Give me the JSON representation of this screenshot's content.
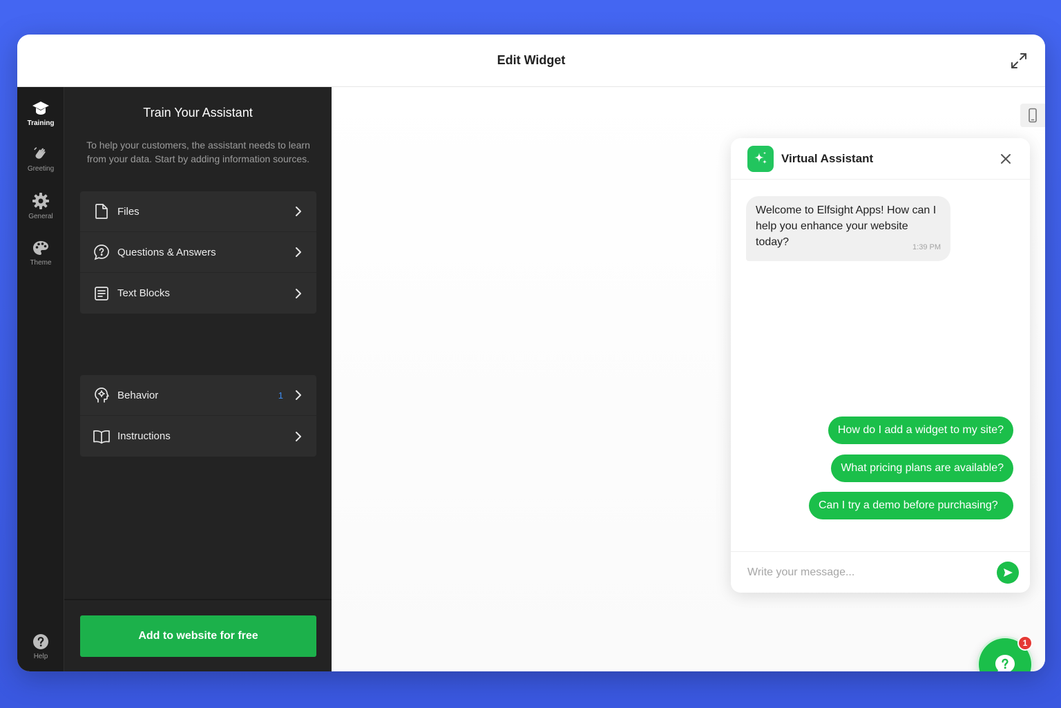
{
  "window": {
    "title": "Edit Widget"
  },
  "rail": {
    "items": [
      {
        "label": "Training",
        "icon": "graduation-cap-icon"
      },
      {
        "label": "Greeting",
        "icon": "waving-hand-icon"
      },
      {
        "label": "General",
        "icon": "gear-icon"
      },
      {
        "label": "Theme",
        "icon": "palette-icon"
      }
    ],
    "help_label": "Help"
  },
  "panel": {
    "title": "Train Your Assistant",
    "description": "To help your customers, the assistant needs to learn from your data. Start by adding information sources.",
    "sources": [
      {
        "label": "Files",
        "icon": "file-icon"
      },
      {
        "label": "Questions & Answers",
        "icon": "question-bubble-icon"
      },
      {
        "label": "Text Blocks",
        "icon": "text-block-icon"
      }
    ],
    "settings": [
      {
        "label": "Behavior",
        "icon": "head-gear-icon",
        "count": "1"
      },
      {
        "label": "Instructions",
        "icon": "book-icon"
      }
    ],
    "cta_label": "Add to website for free"
  },
  "chat": {
    "name": "Virtual Assistant",
    "bot_message": "Welcome to Elfsight Apps! How can I help you enhance your website today?",
    "bot_time": "1:39 PM",
    "user_messages": [
      "How do I add a widget to my site?",
      "What pricing plans are available?",
      "Can I try a demo before purchasing?"
    ],
    "input_placeholder": "Write your message...",
    "badge_count": "1"
  },
  "colors": {
    "accent_green": "#1bbf4a",
    "panel_dark": "#232323",
    "rail_dark": "#1c1c1c",
    "background_blue": "#4466f2",
    "badge_red": "#e53935",
    "count_blue": "#3d8cf0"
  }
}
